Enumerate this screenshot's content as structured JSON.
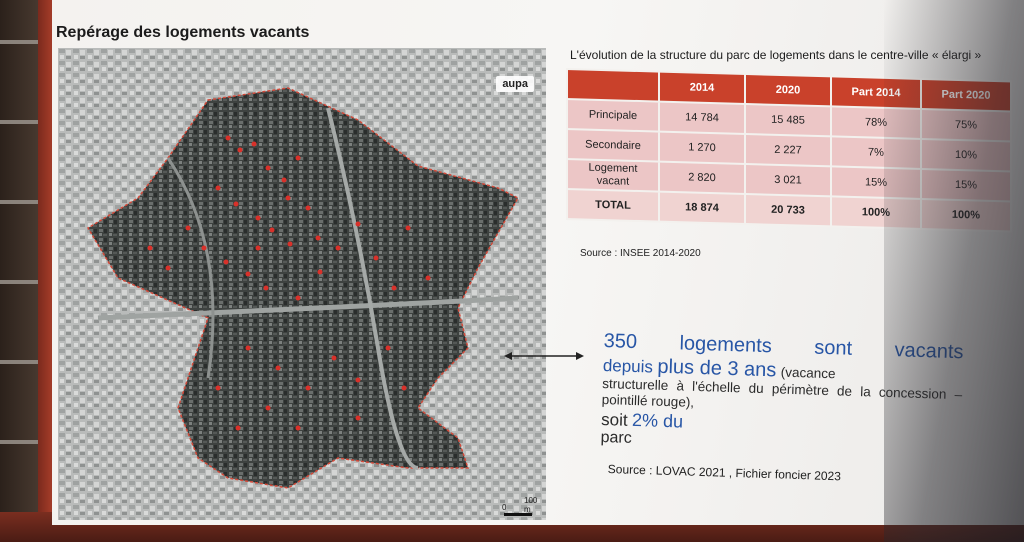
{
  "map": {
    "title": "Repérage des logements vacants",
    "logo_text": "aupa",
    "scale_zero": "0",
    "scale_label": "100 m"
  },
  "table": {
    "title": "L'évolution de la structure du parc de logements dans le centre-ville « élargi »",
    "headers": [
      "",
      "2014",
      "2020",
      "Part 2014",
      "Part 2020"
    ],
    "rows": [
      {
        "label": "Principale",
        "v2014": "14 784",
        "v2020": "15 485",
        "p2014": "78%",
        "p2020": "75%"
      },
      {
        "label": "Secondaire",
        "v2014": "1 270",
        "v2020": "2 227",
        "p2014": "7%",
        "p2020": "10%"
      },
      {
        "label": "Logement vacant",
        "v2014": "2 820",
        "v2020": "3 021",
        "p2014": "15%",
        "p2020": "15%"
      },
      {
        "label": "TOTAL",
        "v2014": "18 874",
        "v2020": "20 733",
        "p2014": "100%",
        "p2020": "100%"
      }
    ],
    "source": "Source : INSEE 2014-2020"
  },
  "callout": {
    "line1": "350 logements sont vacants",
    "line2_a": "depuis",
    "line2_b": "plus de 3 ans",
    "line2_c": "(vacance",
    "line3": "structurelle à l'échelle du périmètre de la concession – pointillé rouge),",
    "line4_a": "soit",
    "line4_b": "2% du",
    "line5": "parc",
    "source": "Source : LOVAC 2021 , Fichier foncier 2023"
  },
  "colors": {
    "accent_red": "#c9412b",
    "row_pink": "#ecc6c6",
    "highlight_blue": "#2856a6"
  }
}
